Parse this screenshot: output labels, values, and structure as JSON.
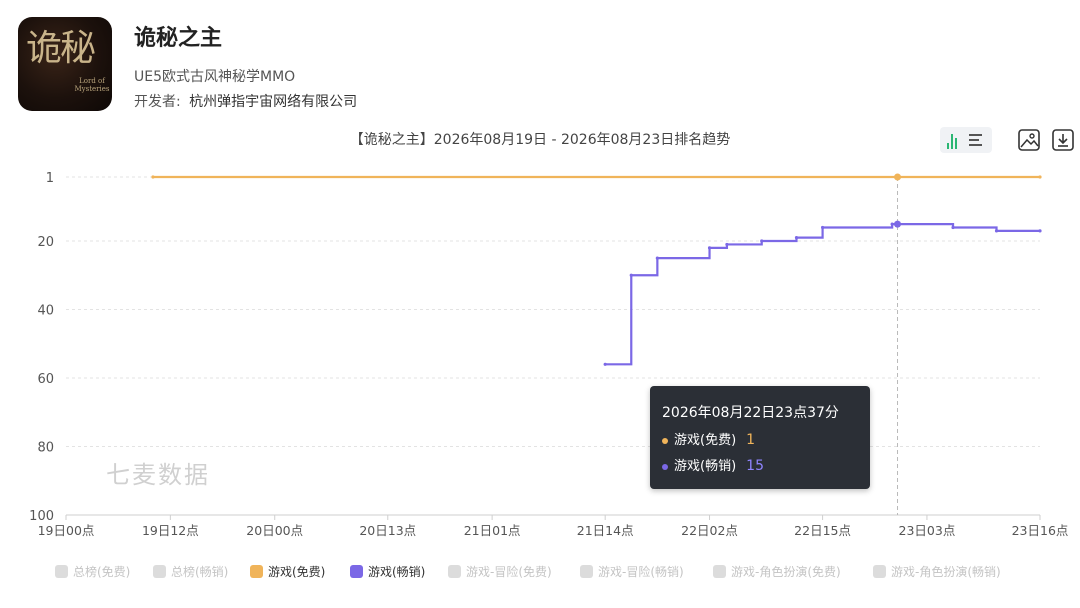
{
  "app": {
    "name": "诡秘之主",
    "icon_text": "诡秘",
    "icon_subtitle": "Lord of Mysteries",
    "description": "UE5欧式古风神秘学MMO",
    "developer_label": "开发者:",
    "developer": "杭州弹指宇宙网络有限公司"
  },
  "toolbar": {
    "view_toggle_icons": [
      "bar-chart-icon",
      "list-icon"
    ],
    "save_image_icon": "image-icon",
    "download_icon": "download-icon"
  },
  "tooltip": {
    "title": "2026年08月22日23点37分",
    "rows": [
      {
        "label": "游戏(免费)",
        "value": "1",
        "color": "#f0b45a"
      },
      {
        "label": "游戏(畅销)",
        "value": "15",
        "color": "#7b68e6"
      }
    ]
  },
  "watermark": "七麦数据",
  "chart_data": {
    "type": "line",
    "title": "【诡秘之主】2026年08月19日 - 2026年08月23日排名趋势",
    "x_ticks": [
      "19日00点",
      "19日12点",
      "20日00点",
      "20日13点",
      "21日01点",
      "21日14点",
      "22日02点",
      "22日15点",
      "23日03点",
      "23日16点"
    ],
    "y_ticks": [
      1,
      20,
      40,
      60,
      80,
      100
    ],
    "ylim": [
      1,
      100
    ],
    "y_inverted": true,
    "grid": true,
    "legend_position": "bottom",
    "legend": [
      {
        "name": "总榜(免费)",
        "active": false
      },
      {
        "name": "总榜(畅销)",
        "active": false
      },
      {
        "name": "游戏(免费)",
        "active": true,
        "color": "#f0b45a"
      },
      {
        "name": "游戏(畅销)",
        "active": true,
        "color": "#7b68e6"
      },
      {
        "name": "游戏-冒险(免费)",
        "active": false
      },
      {
        "name": "游戏-冒险(畅销)",
        "active": false
      },
      {
        "name": "游戏-角色扮演(免费)",
        "active": false
      },
      {
        "name": "游戏-角色扮演(畅销)",
        "active": false
      }
    ],
    "series": [
      {
        "name": "游戏(免费)",
        "color": "#f0b45a",
        "step": false,
        "x": [
          "19日10点",
          "23日16点"
        ],
        "values": [
          1,
          1
        ]
      },
      {
        "name": "游戏(畅销)",
        "color": "#7b68e6",
        "step": true,
        "x": [
          "21日14点",
          "21日17点",
          "21日20点",
          "22日02点",
          "22日04点",
          "22日08点",
          "22日12点",
          "22日15点",
          "22日23点",
          "23日06点",
          "23日11点",
          "23日16点"
        ],
        "values": [
          56,
          30,
          25,
          22,
          21,
          20,
          19,
          16,
          15,
          16,
          17,
          17
        ]
      }
    ],
    "highlight_x": "22日23点37分"
  }
}
